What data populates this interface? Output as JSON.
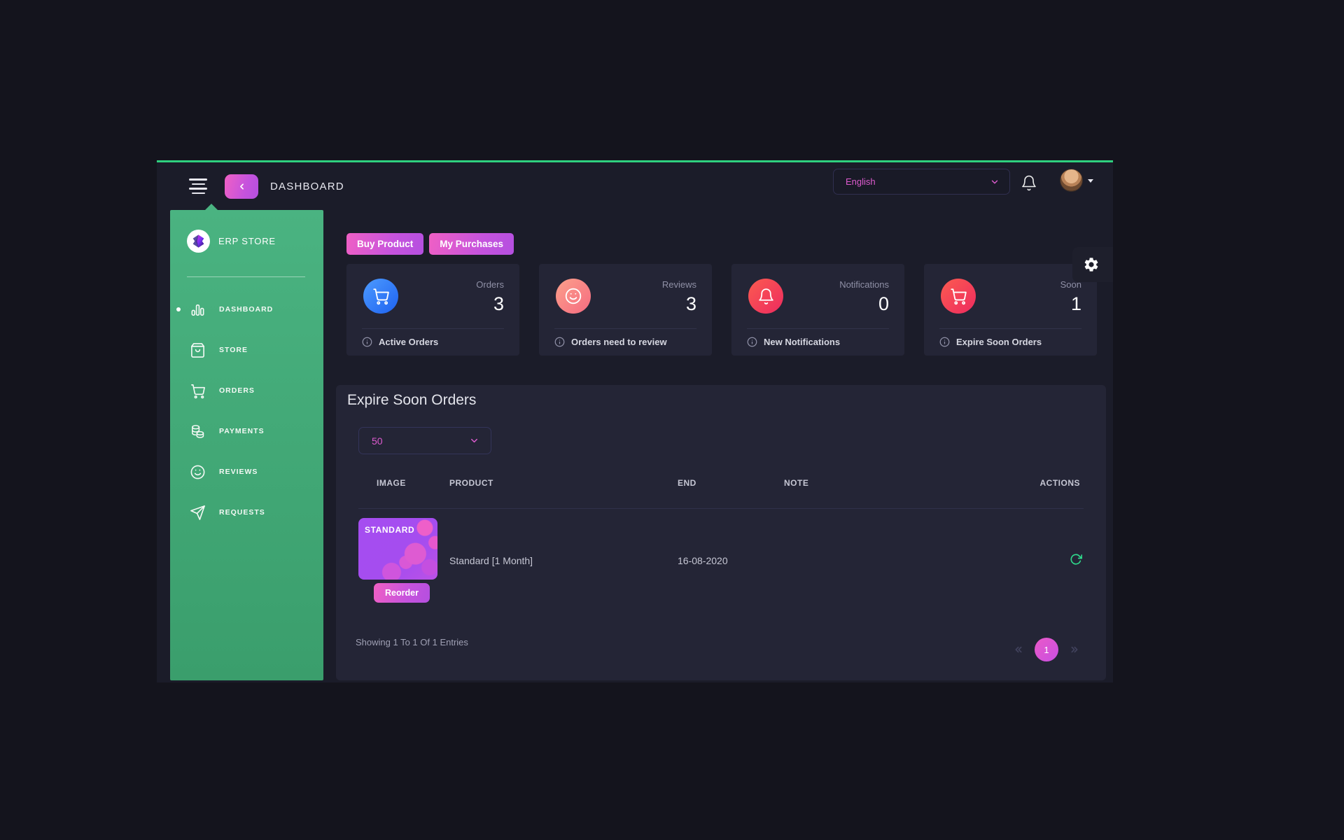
{
  "header": {
    "title": "DASHBOARD",
    "language_selected": "English"
  },
  "sidebar": {
    "brand": "ERP STORE",
    "items": [
      {
        "label": "DASHBOARD",
        "icon": "bar-chart-icon",
        "active": true
      },
      {
        "label": "STORE",
        "icon": "shopping-bag-icon",
        "active": false
      },
      {
        "label": "ORDERS",
        "icon": "shopping-cart-icon",
        "active": false
      },
      {
        "label": "PAYMENTS",
        "icon": "coins-icon",
        "active": false
      },
      {
        "label": "REVIEWS",
        "icon": "smiley-icon",
        "active": false
      },
      {
        "label": "REQUESTS",
        "icon": "paper-plane-icon",
        "active": false
      }
    ]
  },
  "toolbar": {
    "buy_product_label": "Buy Product",
    "my_purchases_label": "My Purchases"
  },
  "stats": [
    {
      "label": "Orders",
      "value": "3",
      "caption": "Active Orders",
      "icon": "shopping-cart-icon",
      "icon_color": "#2e7bf6"
    },
    {
      "label": "Reviews",
      "value": "3",
      "caption": "Orders need to review",
      "icon": "smiley-icon",
      "icon_color": "#f88787"
    },
    {
      "label": "Notifications",
      "value": "0",
      "caption": "New Notifications",
      "icon": "bell-icon",
      "icon_color": "#f43b55"
    },
    {
      "label": "Soon",
      "value": "1",
      "caption": "Expire Soon Orders",
      "icon": "shopping-cart-icon",
      "icon_color": "#f43b55"
    }
  ],
  "orders_panel": {
    "title": "Expire Soon Orders",
    "page_size": "50",
    "columns": [
      "IMAGE",
      "PRODUCT",
      "END",
      "NOTE",
      "ACTIONS"
    ],
    "rows": [
      {
        "image_label": "STANDARD",
        "product": "Standard [1 Month]",
        "end": "16-08-2020",
        "note": "",
        "reorder_label": "Reorder"
      }
    ],
    "summary": "Showing 1 To 1 Of 1 Entries",
    "pagination": {
      "current_page": "1"
    }
  },
  "colors": {
    "accent_green": "#2fd07f",
    "sidebar_green": "#42a974",
    "magenta_text": "#dd5bcf",
    "button_gradient_start": "#f060c4",
    "button_gradient_end": "#b44fe0",
    "stat_blue": "#2e7bf6",
    "stat_salmon": "#f88787",
    "stat_red": "#f43b55",
    "reload_green": "#2fd98c"
  }
}
